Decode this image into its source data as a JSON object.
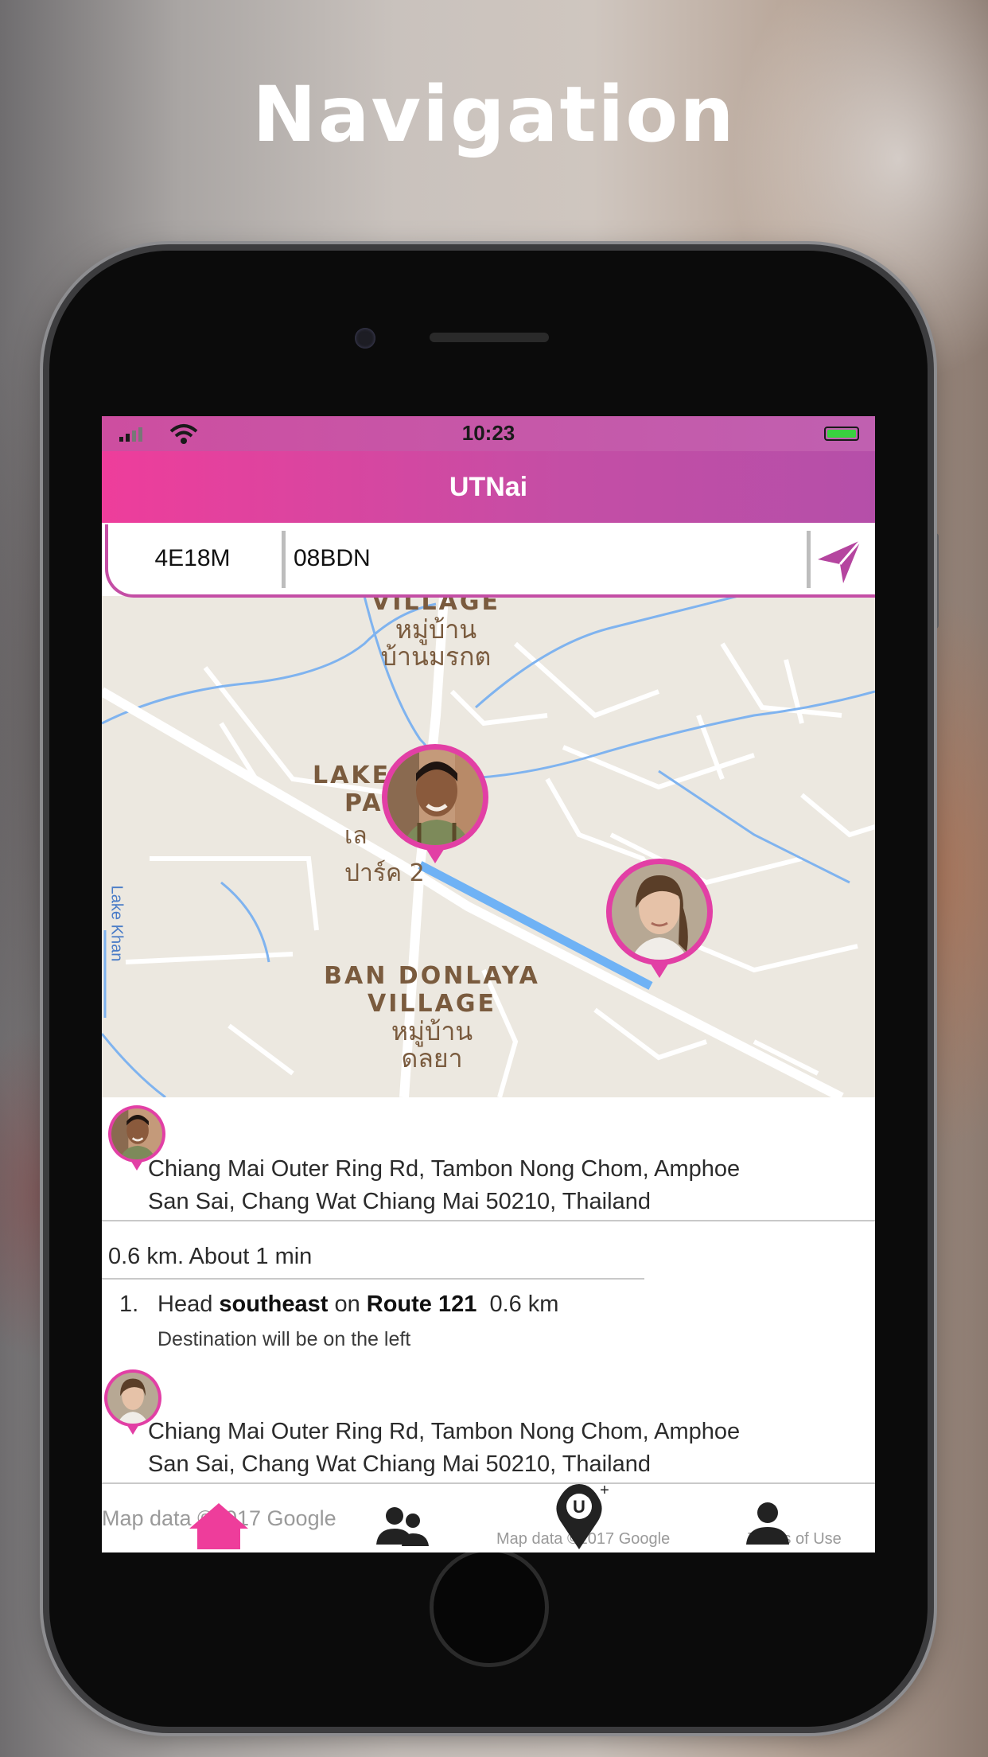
{
  "hero": {
    "title": "Navigation"
  },
  "status_bar": {
    "time": "10:23"
  },
  "app": {
    "title": "UTNai"
  },
  "code_bar": {
    "code_left": "4E18M",
    "code_right": "08BDN",
    "send_icon": "send-arrow-icon"
  },
  "map": {
    "labels": {
      "village_top_en": "VILLAGE",
      "village_top_th1": "หมู่บ้าน",
      "village_top_th2": "บ้านมรกต",
      "lakeside_en1": "LAKESIDE",
      "lakeside_en2": "PA",
      "lakeside_th1": "เล",
      "lakeside_th2": "ปาร์ค 2",
      "donlaya_en1": "BAN DONLAYA",
      "donlaya_en2": "VILLAGE",
      "donlaya_th1": "หมู่บ้าน",
      "donlaya_th2": "ดลยา",
      "lake_label": "Lake Khan"
    }
  },
  "directions": {
    "origin_address_line1": "Chiang Mai Outer Ring Rd, Tambon Nong Chom, Amphoe",
    "origin_address_line2": "San Sai, Chang Wat Chiang Mai 50210, Thailand",
    "summary": "0.6 km. About 1 min",
    "steps": [
      {
        "number": "1.",
        "verb": "Head",
        "direction": "southeast",
        "preposition": "on",
        "road": "Route 121",
        "distance": "0.6 km",
        "note": "Destination will be on the left"
      }
    ],
    "destination_address_line1": "Chiang Mai Outer Ring Rd, Tambon Nong Chom, Amphoe",
    "destination_address_line2": "San Sai, Chang Wat Chiang Mai 50210, Thailand"
  },
  "attribution": {
    "left": "Map data ©2017 Google",
    "right_data": "Map data ©2017 Google",
    "terms": "Terms of Use"
  },
  "tabs": [
    {
      "icon": "home-icon",
      "active": true
    },
    {
      "icon": "friends-icon",
      "active": false
    },
    {
      "icon": "add-location-icon",
      "active": false
    },
    {
      "icon": "profile-icon",
      "active": false
    }
  ],
  "colors": {
    "accent": "#e23fa5",
    "header_start": "#ee3d9b",
    "header_end": "#b54fa9",
    "route": "#6fb2f5"
  }
}
